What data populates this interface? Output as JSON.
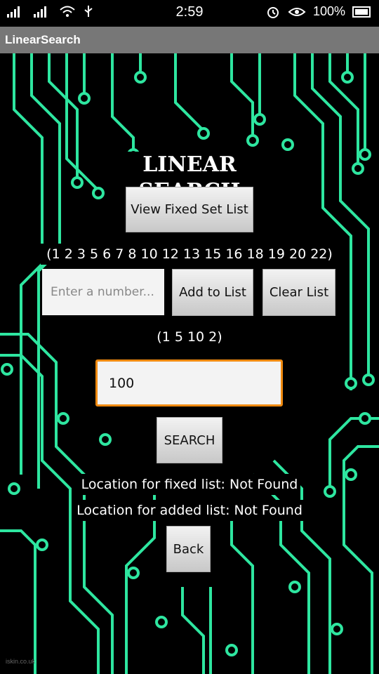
{
  "status_bar": {
    "time": "2:59",
    "battery": "100%",
    "icons": [
      "signal-icon",
      "signal-2-icon",
      "wifi-icon",
      "usb-icon",
      "alarm-icon",
      "eye-icon",
      "battery-icon"
    ]
  },
  "app": {
    "title": "LinearSearch"
  },
  "main": {
    "heading": "LINEAR SEARCH",
    "view_fixed_button": "View Fixed Set List",
    "fixed_list": "(1 2 3 5 6 7 8 10 12 13 15 16 18 19 20 22)",
    "number_input": {
      "placeholder": "Enter a number...",
      "value": ""
    },
    "add_button": "Add to List",
    "clear_button": "Clear List",
    "added_list": "(1 5 10 2)",
    "search_input": {
      "value": "100"
    },
    "search_button": "SEARCH",
    "result_fixed": "Location for fixed list: Not Found",
    "result_added": "Location for added list: Not Found",
    "back_button": "Back"
  },
  "watermark": "iskin.co.uk",
  "colors": {
    "trace": "#2ee6a0",
    "background": "#000000",
    "accent": "#f08a10",
    "titlebar": "#777777"
  }
}
